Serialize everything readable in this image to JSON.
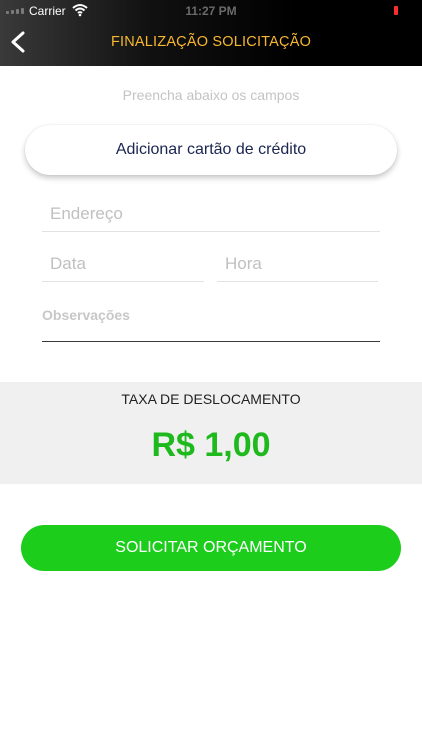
{
  "status_bar": {
    "carrier": "Carrier",
    "time": "11:27 PM"
  },
  "header": {
    "title": "FINALIZAÇÃO SOLICITAÇÃO"
  },
  "form": {
    "subtitle": "Preencha abaixo os campos",
    "add_card_label": "Adicionar cartão de crédito",
    "address_placeholder": "Endereço",
    "date_placeholder": "Data",
    "hour_placeholder": "Hora",
    "notes_placeholder": "Observações"
  },
  "fee": {
    "label": "TAXA DE DESLOCAMENTO",
    "value": "R$ 1,00"
  },
  "submit_label": "SOLICITAR ORÇAMENTO",
  "colors": {
    "accent": "#f7b731",
    "primary": "#1ccd1c",
    "price": "#1db91d"
  },
  "icons": [
    "signal-icon",
    "wifi-icon",
    "battery-icon",
    "back-chevron-icon"
  ]
}
